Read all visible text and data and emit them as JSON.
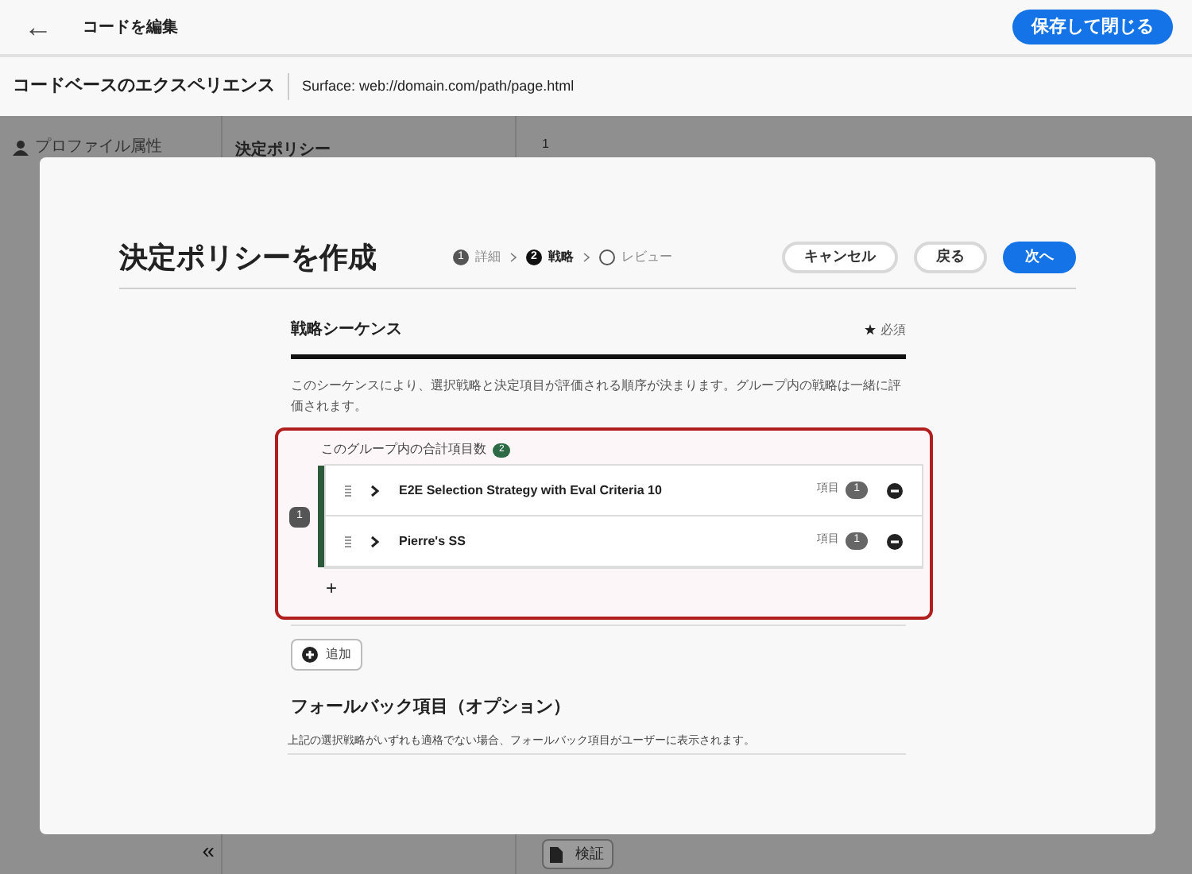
{
  "header": {
    "back_label": "←",
    "title": "コードを編集",
    "save_button": "保存して閉じる"
  },
  "subheader": {
    "title": "コードベースのエクスペリエンス",
    "surface": "Surface: web://domain.com/path/page.html"
  },
  "background": {
    "sidebar_item": "プロファイル属性",
    "column_title": "決定ポリシー",
    "line_number": "1",
    "collapse": "«",
    "validate_button": "検証"
  },
  "modal": {
    "title": "決定ポリシーを作成",
    "steps": [
      {
        "number": "1",
        "label": "詳細",
        "selected": false
      },
      {
        "number": "2",
        "label": "戦略",
        "selected": true
      },
      {
        "label": "レビュー",
        "selected": false
      }
    ],
    "buttons": [
      {
        "label": "キャンセル",
        "kind": "outline"
      },
      {
        "label": "戻る",
        "kind": "outline"
      },
      {
        "label": "次へ",
        "kind": "primary"
      }
    ],
    "section": {
      "title": "戦略シーケンス",
      "required": "必須",
      "description": "このシーケンスにより、選択戦略と決定項目が評価される順序が決まります。グループ内の戦略は一緒に評価されます。",
      "group": {
        "index": "1",
        "count_label": "このグループ内の合計項目数",
        "count": "2",
        "items": [
          {
            "name": "E2E Selection Strategy with Eval Criteria 10",
            "items_label": "項目",
            "items_count": "1"
          },
          {
            "name": "Pierre's SS",
            "items_label": "項目",
            "items_count": "1"
          }
        ],
        "add_label": "+"
      },
      "add_button": "追加"
    },
    "fallback": {
      "title": "フォールバック項目（オプション）",
      "description": "上記の選択戦略がいずれも適格でない場合、フォールバック項目がユーザーに表示されます。"
    }
  }
}
